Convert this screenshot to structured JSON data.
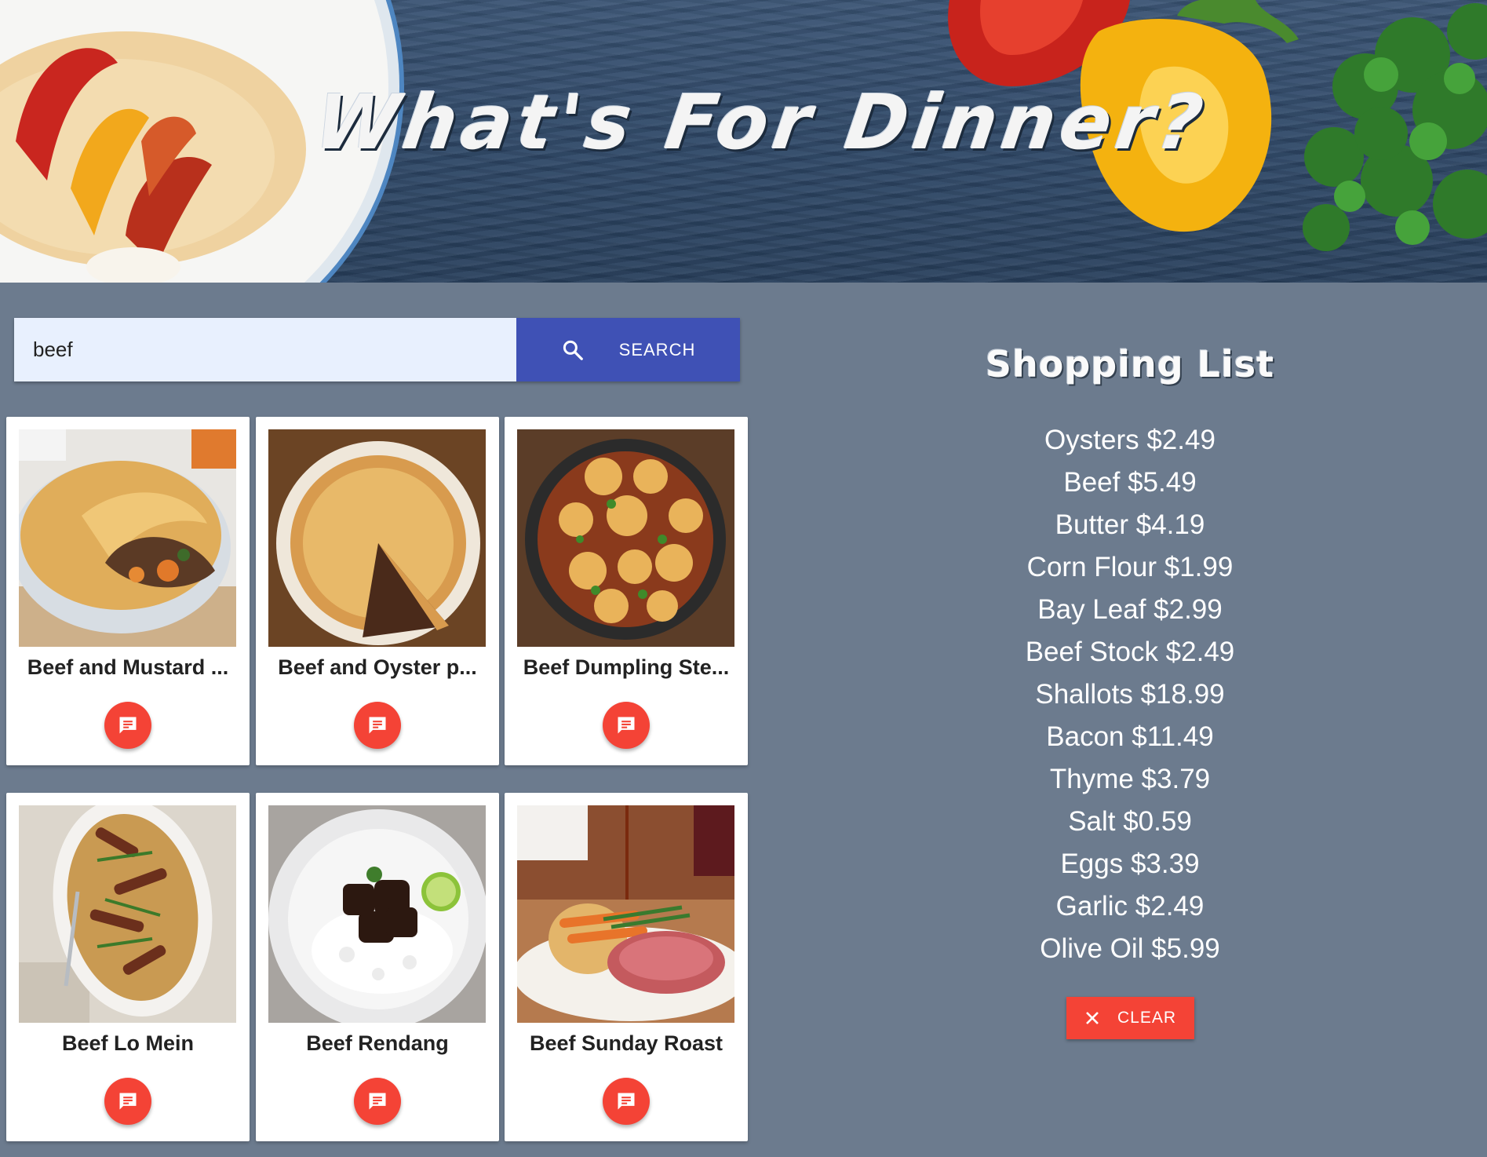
{
  "banner": {
    "title": "What's For Dinner?"
  },
  "search": {
    "value": "beef",
    "button_label": "SEARCH",
    "icon": "search-icon"
  },
  "recipes": [
    {
      "title": "Beef and Mustard ...",
      "icon": "comment-icon"
    },
    {
      "title": "Beef and Oyster p...",
      "icon": "comment-icon"
    },
    {
      "title": "Beef Dumpling Ste...",
      "icon": "comment-icon"
    },
    {
      "title": "Beef Lo Mein",
      "icon": "comment-icon"
    },
    {
      "title": "Beef Rendang",
      "icon": "comment-icon"
    },
    {
      "title": "Beef Sunday Roast",
      "icon": "comment-icon"
    }
  ],
  "shopping_list": {
    "heading": "Shopping List",
    "items": [
      "Oysters $2.49",
      "Beef $5.49",
      "Butter $4.19",
      "Corn Flour $1.99",
      "Bay Leaf $2.99",
      "Beef Stock $2.49",
      "Shallots $18.99",
      "Bacon $11.49",
      "Thyme $3.79",
      "Salt $0.59",
      "Eggs $3.39",
      "Garlic $2.49",
      "Olive Oil $5.99"
    ],
    "clear_label": "CLEAR",
    "clear_icon": "close-icon"
  },
  "colors": {
    "background": "#6c7b8e",
    "primary": "#3f51b5",
    "accent": "#f44336",
    "input_bg": "#e8f0fe"
  }
}
